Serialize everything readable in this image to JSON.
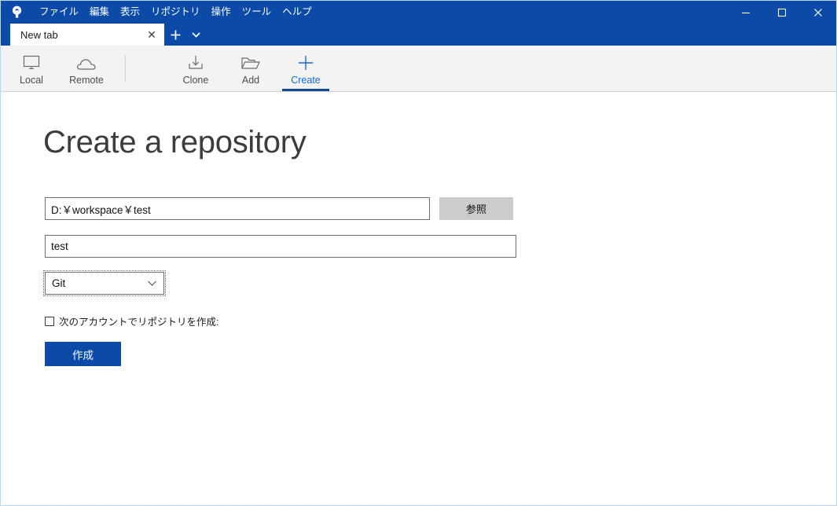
{
  "window": {
    "logo_icon": "sourcetree-logo-icon",
    "controls": {
      "minimize": "—",
      "maximize": "□",
      "close": "✕"
    }
  },
  "menubar": {
    "items": [
      {
        "label": "ファイル"
      },
      {
        "label": "編集"
      },
      {
        "label": "表示"
      },
      {
        "label": "リポジトリ"
      },
      {
        "label": "操作"
      },
      {
        "label": "ツール"
      },
      {
        "label": "ヘルプ"
      }
    ]
  },
  "tabs": {
    "items": [
      {
        "label": "New tab",
        "close_glyph": "✕",
        "active": true
      }
    ],
    "new_tab_glyph": "+",
    "dropdown_glyph": "▾"
  },
  "toolbar": {
    "items": [
      {
        "label": "Local",
        "icon": "monitor-icon",
        "active": false
      },
      {
        "label": "Remote",
        "icon": "cloud-icon",
        "active": false
      },
      {
        "label": "Clone",
        "icon": "download-icon",
        "active": false
      },
      {
        "label": "Add",
        "icon": "open-folder-icon",
        "active": false
      },
      {
        "label": "Create",
        "icon": "plus-icon",
        "active": true
      }
    ]
  },
  "main": {
    "title": "Create a repository",
    "destination_path": {
      "value": "D:￥workspace￥test",
      "placeholder": ""
    },
    "browse_button": "参照",
    "repository_name": {
      "value": "test",
      "placeholder": ""
    },
    "repository_type": {
      "selected": "Git",
      "arrow_glyph": "⌄"
    },
    "account_checkbox": {
      "label": "次のアカウントでリポジトリを作成:",
      "checked": false
    },
    "create_button": "作成"
  },
  "colors": {
    "titlebar_blue": "#0b4aa6",
    "accent_blue": "#1669d6",
    "underline_blue": "#12488f",
    "toolbar_bg": "#f3f3f3",
    "button_gray": "#cccccc"
  }
}
